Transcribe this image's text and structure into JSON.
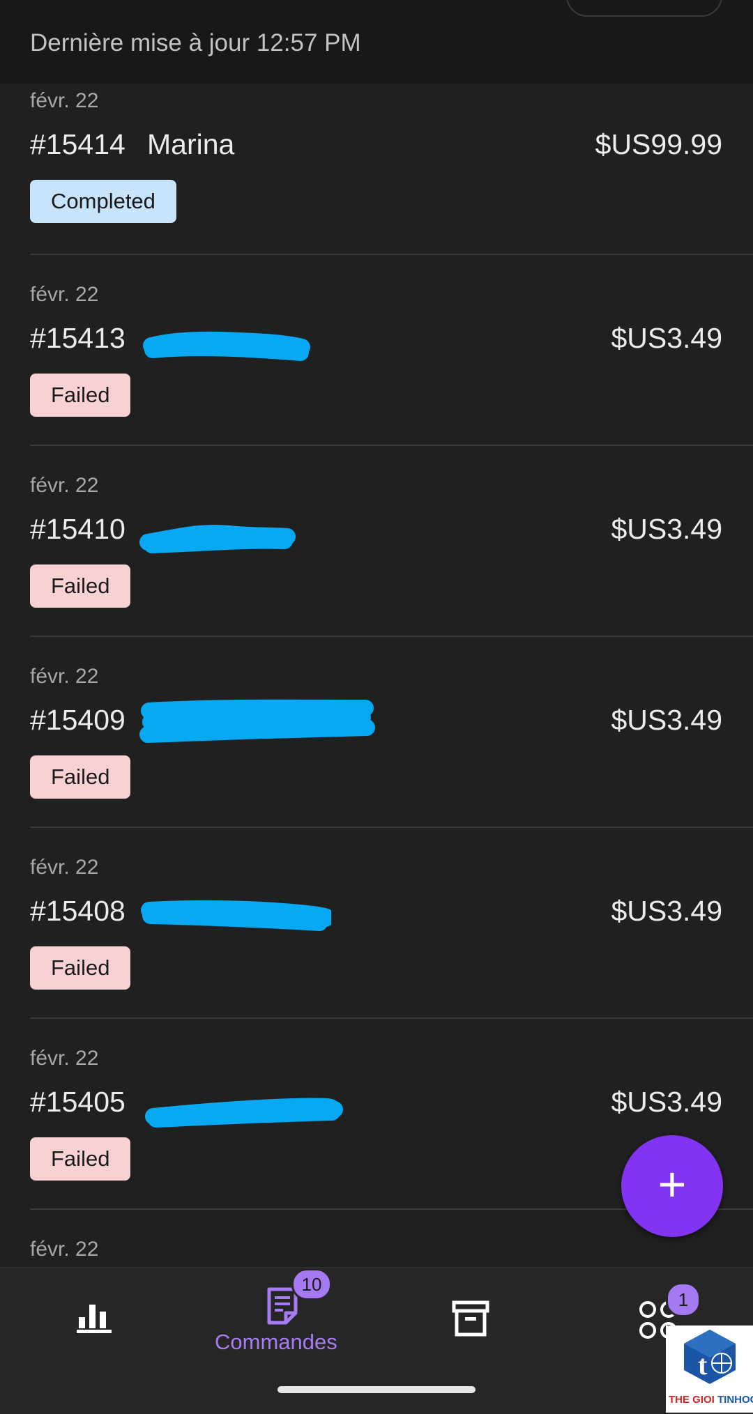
{
  "header": {
    "last_updated": "Dernière mise à jour 12:57 PM"
  },
  "orders": [
    {
      "date": "févr. 22",
      "number": "#15414",
      "customer": "Marina",
      "amount": "$US99.99",
      "status": "Completed"
    },
    {
      "date": "févr. 22",
      "number": "#15413",
      "customer": "",
      "amount": "$US3.49",
      "status": "Failed"
    },
    {
      "date": "févr. 22",
      "number": "#15410",
      "customer": "",
      "amount": "$US3.49",
      "status": "Failed"
    },
    {
      "date": "févr. 22",
      "number": "#15409",
      "customer": "",
      "amount": "$US3.49",
      "status": "Failed"
    },
    {
      "date": "févr. 22",
      "number": "#15408",
      "customer": "",
      "amount": "$US3.49",
      "status": "Failed"
    },
    {
      "date": "févr. 22",
      "number": "#15405",
      "customer": "",
      "amount": "$US3.49",
      "status": "Failed"
    },
    {
      "date": "févr. 22"
    }
  ],
  "fab": {
    "icon": "plus-icon"
  },
  "nav": {
    "stats": {
      "icon": "bar-chart-icon"
    },
    "orders": {
      "icon": "orders-document-icon",
      "label": "Commandes",
      "badge": "10"
    },
    "archive": {
      "icon": "archive-box-icon"
    },
    "more": {
      "icon": "apps-grid-icon",
      "badge": "1"
    }
  },
  "watermark": {
    "text_red": "THE GIOI",
    "text_blue": "TINHOC"
  },
  "colors": {
    "background": "#202020",
    "accent": "#8234f2",
    "completed_badge": "#c7e4fb",
    "failed_badge": "#f8d2d3",
    "redaction": "#06a9f2"
  }
}
